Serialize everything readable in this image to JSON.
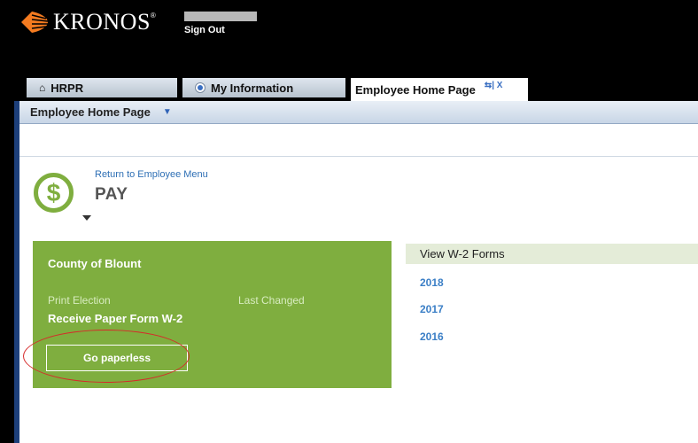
{
  "header": {
    "brand": "KRONOS",
    "brand_mark": "®",
    "sign_out": "Sign Out"
  },
  "tabs": [
    {
      "label": "HRPR",
      "icon": "home-icon"
    },
    {
      "label": "My Information",
      "icon": "radio-icon"
    },
    {
      "label": "Employee Home Page",
      "controls": "⇆| X"
    }
  ],
  "pagebar": {
    "title": "Employee Home Page"
  },
  "pay": {
    "return_link": "Return to Employee Menu",
    "title": "PAY",
    "icon_glyph": "$"
  },
  "panel": {
    "county": "County of Blount",
    "print_election_label": "Print Election",
    "last_changed_label": "Last Changed",
    "election_value": "Receive Paper Form W-2",
    "go_paperless": "Go paperless"
  },
  "w2": {
    "header": "View W-2 Forms",
    "years": [
      "2018",
      "2017",
      "2016"
    ]
  },
  "colors": {
    "accent_green": "#7fae3f",
    "link_blue": "#3b7fc6",
    "highlight_red": "#d62a2a"
  }
}
